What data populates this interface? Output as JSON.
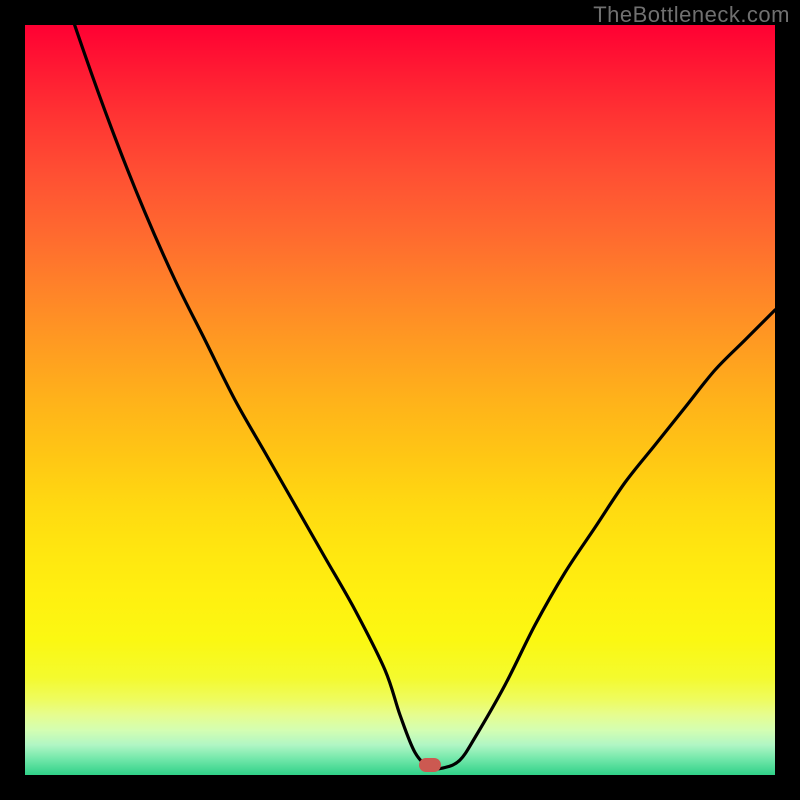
{
  "watermark": "TheBottleneck.com",
  "marker": {
    "x_pct": 54.0,
    "y_pct": 98.6
  },
  "colors": {
    "frame": "#000000",
    "curve": "#000000",
    "marker": "#cc5951",
    "watermark_text": "#707070"
  },
  "chart_data": {
    "type": "line",
    "title": "",
    "xlabel": "",
    "ylabel": "",
    "xlim": [
      0,
      100
    ],
    "ylim": [
      0,
      100
    ],
    "note": "Values are approximate readings of the black V-shaped bottleneck curve; y is displayed top-down (100 at top of gradient, 0 at bottom).",
    "series": [
      {
        "name": "bottleneck-curve",
        "x": [
          0,
          4,
          8,
          12,
          16,
          20,
          24,
          28,
          32,
          36,
          40,
          44,
          48,
          50,
          52,
          54,
          56,
          58,
          60,
          64,
          68,
          72,
          76,
          80,
          84,
          88,
          92,
          96,
          100
        ],
        "y": [
          122,
          108,
          96,
          85,
          75,
          66,
          58,
          50,
          43,
          36,
          29,
          22,
          14,
          8,
          3,
          1,
          1,
          2,
          5,
          12,
          20,
          27,
          33,
          39,
          44,
          49,
          54,
          58,
          62
        ]
      }
    ],
    "marker_point": {
      "x": 54,
      "y": 1
    },
    "background_gradient_stops": [
      {
        "pct": 0,
        "color": "#ff0033"
      },
      {
        "pct": 50,
        "color": "#ffb21a"
      },
      {
        "pct": 82,
        "color": "#fbf812"
      },
      {
        "pct": 100,
        "color": "#30d188"
      }
    ]
  }
}
